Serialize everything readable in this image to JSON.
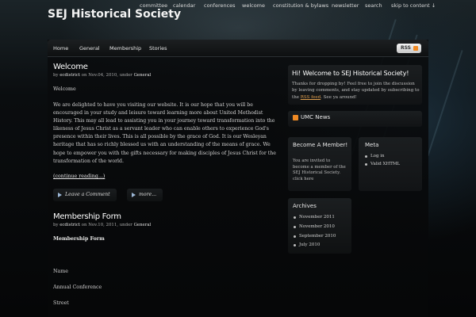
{
  "site": {
    "title": "SEJ Historical Society"
  },
  "topnav": {
    "items": [
      "committee",
      "calendar",
      "conferences",
      "welcome",
      "constitution & bylaws",
      "newsletter",
      "search",
      "skip to content ↓"
    ]
  },
  "mainnav": {
    "items": [
      "Home",
      "General",
      "Membership",
      "Stories"
    ],
    "rss_label": "RSS"
  },
  "posts": [
    {
      "title": "Welcome",
      "meta_prefix": "by",
      "author": "ecdistrict",
      "on": "on",
      "date": "Nov.04, 2010",
      "under": ", under",
      "category": "General",
      "intro": "Welcome",
      "body": "We are delighted to have you visiting our website. It is our hope that you will be encouraged in your study and leisure toward learning more about United Methodist History. This may all lead to assisting you in your journey toward transformation into the likeness of Jesus Christ as a servant leader who can enable others to experience God's presence within their lives. This is all possible by the grace of God. It is our Wesleyan heritage that has so richly blessed us with an understanding of the means of grace. We hope to empower you with the gifts necessary for making disciples of Jesus Christ for the transformation of the world.",
      "continue": "(continue reading...)",
      "comment_label": "Leave a Comment",
      "more_label": "more..."
    },
    {
      "title": "Membership Form",
      "meta_prefix": "by",
      "author": "ecdistrict",
      "on": "on",
      "date": "Nov.10, 2011",
      "under": ", under",
      "category": "General",
      "heading": "Membership Form",
      "fields": [
        "Name",
        "Annual Conference",
        "Street"
      ]
    }
  ],
  "sidebar": {
    "welcome": {
      "title": "Hi! Welcome to SEJ Historical Society!",
      "text_before": "Thanks for dropping by! Feel free to join the discussion by leaving comments, and stay updated by subscribing to the",
      "link": "RSS feed",
      "text_after": ". See ya around!"
    },
    "umc": {
      "title": "UMC News"
    },
    "become": {
      "title": "Become A Member!",
      "text": "You are invited to become a member of the SEJ Historical Society. click here"
    },
    "meta": {
      "title": "Meta",
      "items": [
        "Log in",
        "Valid XHTML"
      ]
    },
    "archives": {
      "title": "Archives",
      "items": [
        "November 2011",
        "November 2010",
        "September 2010",
        "July 2010"
      ]
    }
  },
  "colors": {
    "accent_link": "#e0a050",
    "rss_orange": "#f08a24",
    "background": "#050708"
  }
}
